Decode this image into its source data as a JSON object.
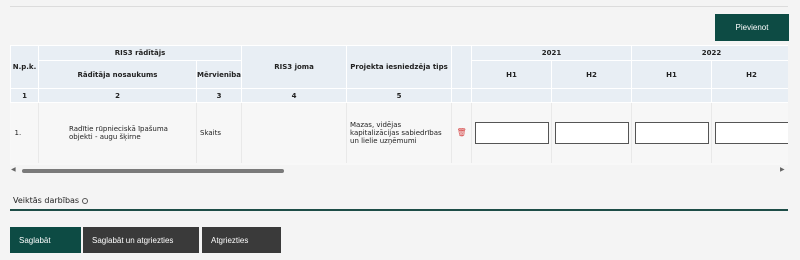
{
  "toolbar": {
    "add_label": "Pievienot"
  },
  "table": {
    "h_npk": "N.p.k.",
    "h_indicator_group": "RIS3 rādītājs",
    "h_indicator_name": "Rādītāja nosaukums",
    "h_unit": "Mērvienība",
    "h_ris3_area": "RIS3 joma",
    "h_submitter_type": "Projekta iesniedzēja tips",
    "years": [
      "2021",
      "2022"
    ],
    "halves": [
      "H1",
      "H2",
      "H1",
      "H2"
    ],
    "col_numbers": [
      "1",
      "2",
      "3",
      "4",
      "5"
    ],
    "row": {
      "npk": "1.",
      "name": "Radītie rūpnieciskā īpašuma objekti - augu šķirne",
      "unit": "Skaits",
      "ris3_area": "",
      "submitter_type": "Mazas, vidējas kapitalizācijas sabiedrības un lielie uzņēmumi",
      "values": [
        "",
        "",
        "",
        ""
      ]
    }
  },
  "section": {
    "title": "Veiktās darbības"
  },
  "actions": {
    "save": "Saglabāt",
    "save_and_back": "Saglabāt un atgriezties",
    "back": "Atgriezties"
  }
}
